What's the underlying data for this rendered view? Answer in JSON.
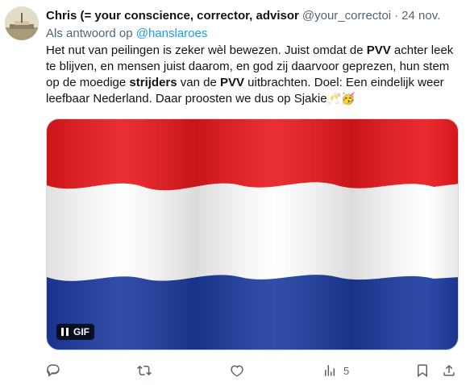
{
  "tweet": {
    "author_name": "Chris (= your conscience, corrector, advisor",
    "author_handle": "@your_correctoi",
    "separator": "·",
    "timestamp": "24 nov.",
    "replying_prefix": "Als antwoord op",
    "replying_to": "@hanslaroes",
    "text_1": "Het nut van peilingen is zeker wèl bewezen. Juist omdat de ",
    "bold_1": "PVV",
    "text_2": " achter leek te blijven, en mensen juist daarom, en god zij daarvoor geprezen, hun stem op de moedige ",
    "bold_2": "strijders",
    "text_3": " van de ",
    "bold_3": "PVV",
    "text_4": " uitbrachten. Doel: Een eindelijk weer leefbaar Nederland. Daar proosten we dus op Sjakie",
    "emoji_1": "🥂",
    "emoji_2": "🥳",
    "media": {
      "badge_label": "GIF",
      "flag_colors": [
        "#e8181c",
        "#ffffff",
        "#1c3a9e"
      ]
    },
    "actions": {
      "reply_icon": "reply-icon",
      "repost_icon": "repost-icon",
      "like_icon": "heart-icon",
      "views_icon": "views-icon",
      "views_count": "5",
      "bookmark_icon": "bookmark-icon",
      "share_icon": "share-icon"
    }
  }
}
